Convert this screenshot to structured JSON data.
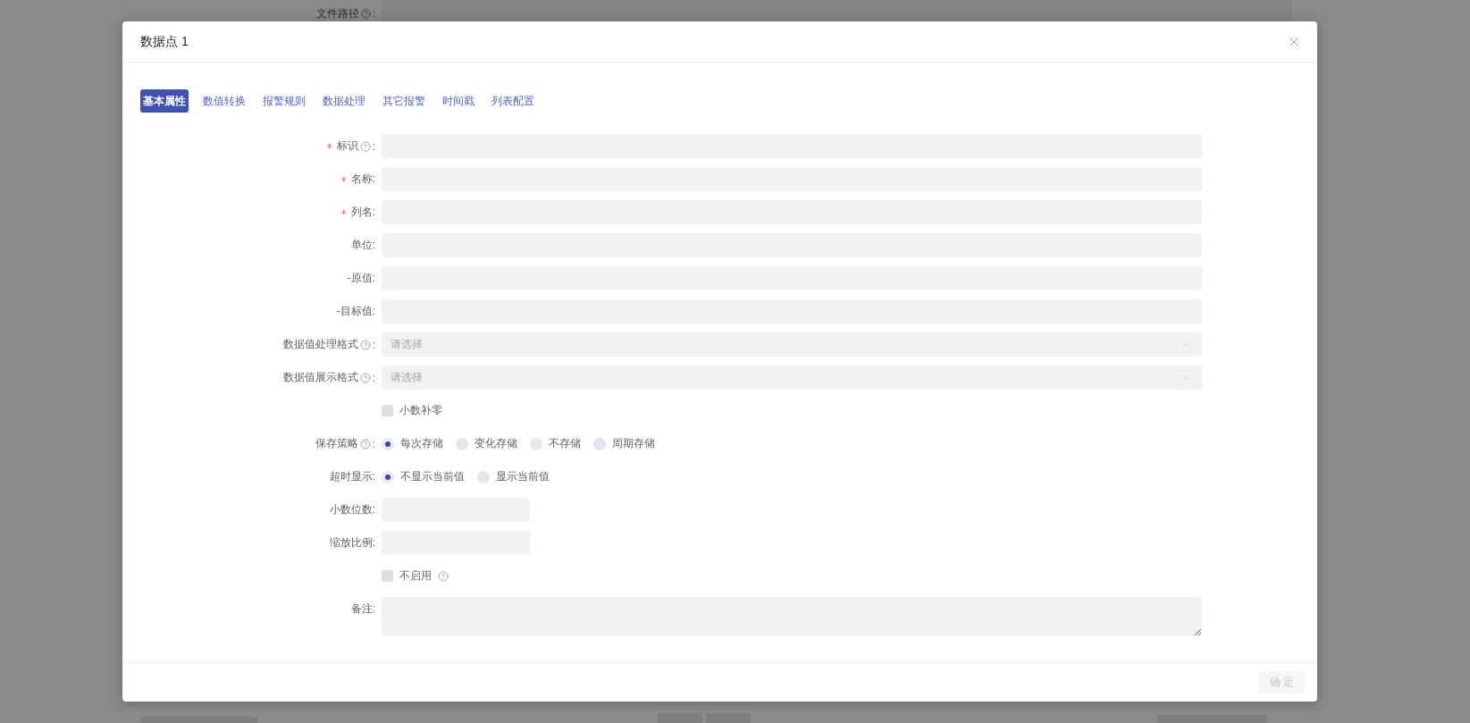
{
  "background_form": {
    "label": "文件路径",
    "help": true,
    "suffix": ":"
  },
  "dialog": {
    "title": "数据点 1",
    "tabs": [
      {
        "label": "基本属性",
        "selected": true
      },
      {
        "label": "数值转换",
        "selected": false
      },
      {
        "label": "报警规则",
        "selected": false
      },
      {
        "label": "数据处理",
        "selected": false
      },
      {
        "label": "其它报警",
        "selected": false
      },
      {
        "label": "时间戳",
        "selected": false
      },
      {
        "label": "列表配置",
        "selected": false
      }
    ],
    "fields": [
      {
        "kind": "text",
        "label": "标识",
        "required": true,
        "help": true,
        "suffix": ":"
      },
      {
        "kind": "text",
        "label": "名称",
        "required": true,
        "help": false,
        "suffix": ":"
      },
      {
        "kind": "text",
        "label": "列名",
        "required": true,
        "help": false,
        "suffix": ":"
      },
      {
        "kind": "text",
        "label": "单位",
        "required": false,
        "help": false,
        "suffix": ":"
      },
      {
        "kind": "text",
        "label": "-原值",
        "required": false,
        "help": false,
        "suffix": ":"
      },
      {
        "kind": "text",
        "label": "-目标值",
        "required": false,
        "help": false,
        "suffix": ":"
      },
      {
        "kind": "select",
        "label": "数据值处理格式",
        "required": false,
        "help": true,
        "suffix": ":",
        "placeholder": "请选择"
      },
      {
        "kind": "select",
        "label": "数据值展示格式",
        "required": false,
        "help": true,
        "suffix": ":",
        "placeholder": "请选择"
      },
      {
        "kind": "checkbox",
        "text": "小数补零",
        "checked": false,
        "help": false
      },
      {
        "kind": "radio",
        "label": "保存策略",
        "required": false,
        "help": true,
        "suffix": ":",
        "options": [
          {
            "label": "每次存储",
            "selected": true
          },
          {
            "label": "变化存储",
            "selected": false
          },
          {
            "label": "不存储",
            "selected": false
          },
          {
            "label": "周期存储",
            "selected": false
          }
        ]
      },
      {
        "kind": "radio",
        "label": "超时显示",
        "required": false,
        "help": false,
        "suffix": ":",
        "options": [
          {
            "label": "不显示当前值",
            "selected": true
          },
          {
            "label": "显示当前值",
            "selected": false
          }
        ]
      },
      {
        "kind": "short",
        "label": "小数位数",
        "required": false,
        "help": false,
        "suffix": ":"
      },
      {
        "kind": "short",
        "label": "缩放比例",
        "required": false,
        "help": false,
        "suffix": ":"
      },
      {
        "kind": "checkbox",
        "text": "不启用",
        "checked": false,
        "help": true
      },
      {
        "kind": "textarea",
        "label": "备注",
        "required": false,
        "help": false,
        "suffix": ":"
      }
    ],
    "confirm_button": {
      "label": "确 定",
      "disabled": true
    }
  }
}
